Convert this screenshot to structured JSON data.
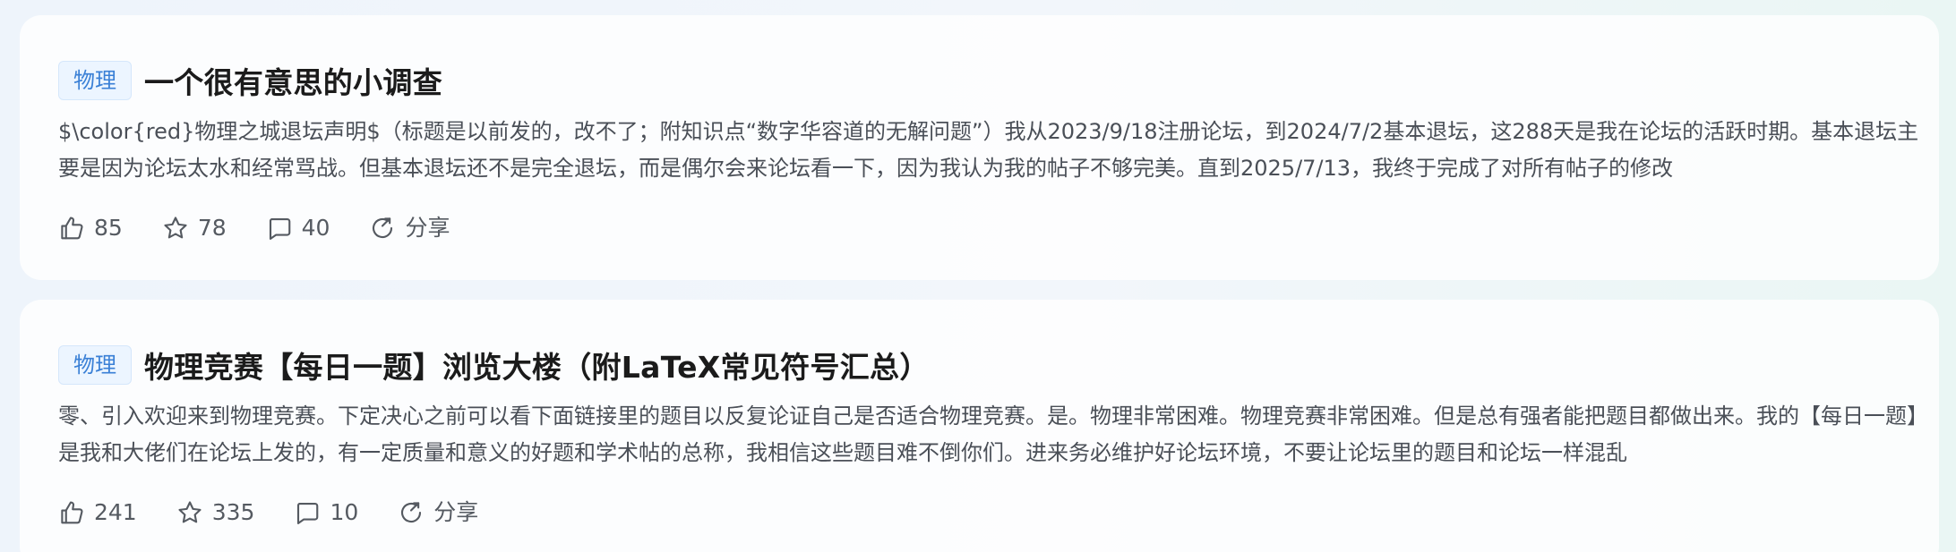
{
  "posts": [
    {
      "tag": "物理",
      "title": "一个很有意思的小调查",
      "excerpt": "$\\color{red}物理之城退坛声明$（标题是以前发的，改不了；附知识点“数字华容道的无解问题”）我从2023/9/18注册论坛，到2024/7/2基本退坛，这288天是我在论坛的活跃时期。基本退坛主要是因为论坛太水和经常骂战。但基本退坛还不是完全退坛，而是偶尔会来论坛看一下，因为我认为我的帖子不够完美。直到2025/7/13，我终于完成了对所有帖子的修改",
      "likes": "85",
      "favorites": "78",
      "comments": "40",
      "share": "分享"
    },
    {
      "tag": "物理",
      "title": "物理竞赛【每日一题】浏览大楼（附LaTeX常见符号汇总）",
      "excerpt": "零、引入欢迎来到物理竞赛。下定决心之前可以看下面链接里的题目以反复论证自己是否适合物理竞赛。是。物理非常困难。物理竞赛非常困难。但是总有强者能把题目都做出来。我的【每日一题】是我和大佬们在论坛上发的，有一定质量和意义的好题和学术帖的总称，我相信这些题目难不倒你们。进来务必维护好论坛环境，不要让论坛里的题目和论坛一样混乱",
      "likes": "241",
      "favorites": "335",
      "comments": "10",
      "share": "分享"
    }
  ],
  "icons": {
    "like": "thumbs-up-icon",
    "favorite": "star-icon",
    "comment": "comment-icon",
    "share": "share-icon"
  },
  "colors": {
    "tag_text": "#3a80d6",
    "tag_bg": "#ecf5ff",
    "title": "#1b1b1b",
    "body_text": "#4a4f57"
  }
}
